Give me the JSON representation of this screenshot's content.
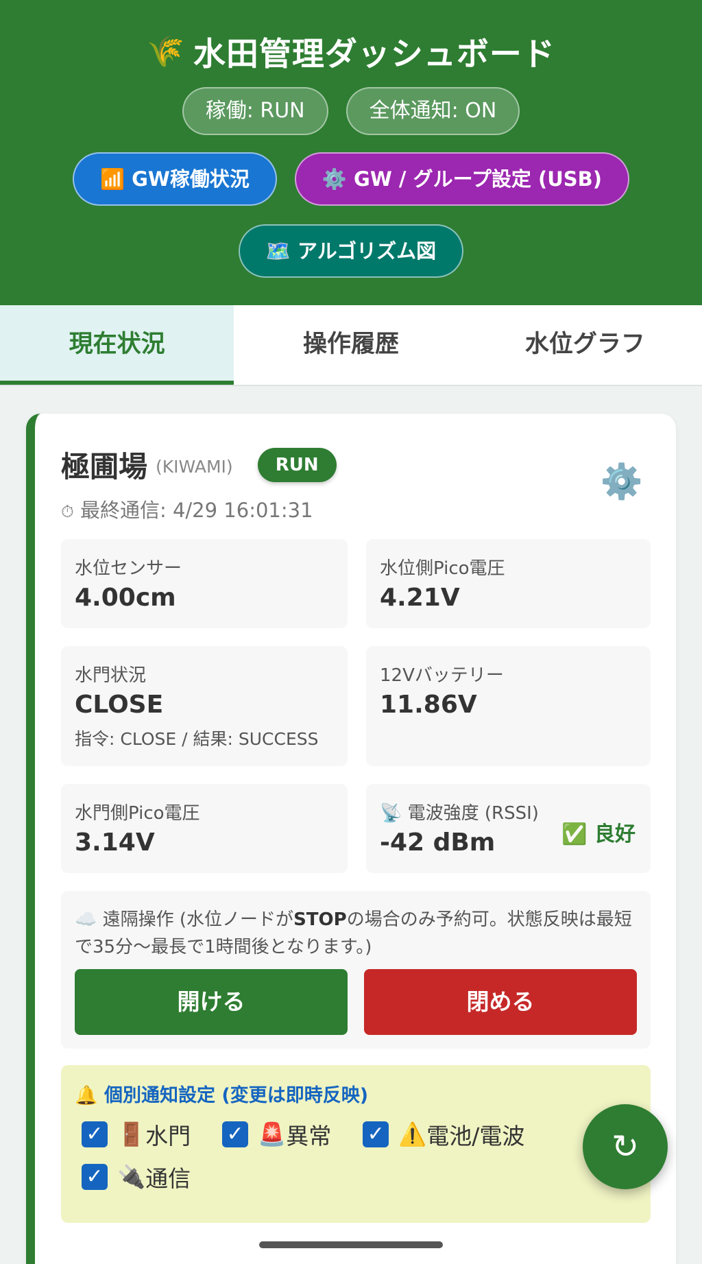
{
  "header": {
    "title": "水田管理ダッシュボード",
    "status_pills": [
      "稼働: RUN",
      "全体通知: ON"
    ],
    "nav_buttons": {
      "gw_status": "GW稼働状況",
      "gw_settings": "GW / グループ設定 (USB)",
      "algorithm": "アルゴリズム図"
    }
  },
  "tabs": [
    "現在状況",
    "操作履歴",
    "水位グラフ"
  ],
  "card": {
    "name": "極圃場",
    "code": "(KIWAMI)",
    "badge": "RUN",
    "last_comm_label": "最終通信:",
    "last_comm_value": "4/29 16:01:31",
    "tiles": {
      "water_sensor": {
        "label": "水位センサー",
        "value": "4.00cm"
      },
      "water_pico": {
        "label": "水位側Pico電圧",
        "value": "4.21V"
      },
      "gate_status": {
        "label": "水門状況",
        "value": "CLOSE",
        "sub": "指令: CLOSE / 結果: SUCCESS"
      },
      "battery": {
        "label": "12Vバッテリー",
        "value": "11.86V"
      },
      "gate_pico": {
        "label": "水門側Pico電圧",
        "value": "3.14V"
      },
      "rssi": {
        "label": "電波強度 (RSSI)",
        "value": "-42 dBm",
        "status": "良好"
      }
    },
    "remote": {
      "text_prefix": "遠隔操作 (水位ノードが",
      "text_bold": "STOP",
      "text_suffix": "の場合のみ予約可。状態反映は最短で35分〜最長で1時間後となります。)",
      "open_label": "開ける",
      "close_label": "閉める"
    },
    "notify": {
      "title": "個別通知設定 (変更は即時反映)",
      "items": [
        "水門",
        "異常",
        "電池/電波",
        "通信"
      ]
    }
  },
  "icons": {
    "title": "rice-icon",
    "gw_status": "signal-icon",
    "gw_settings": "gear-icon",
    "algorithm": "map-icon",
    "refresh": "refresh-icon"
  },
  "colors": {
    "primary": "#2e7d32",
    "danger": "#c62828",
    "blue": "#1976d2",
    "purple": "#9c27b0",
    "teal": "#00796b"
  }
}
